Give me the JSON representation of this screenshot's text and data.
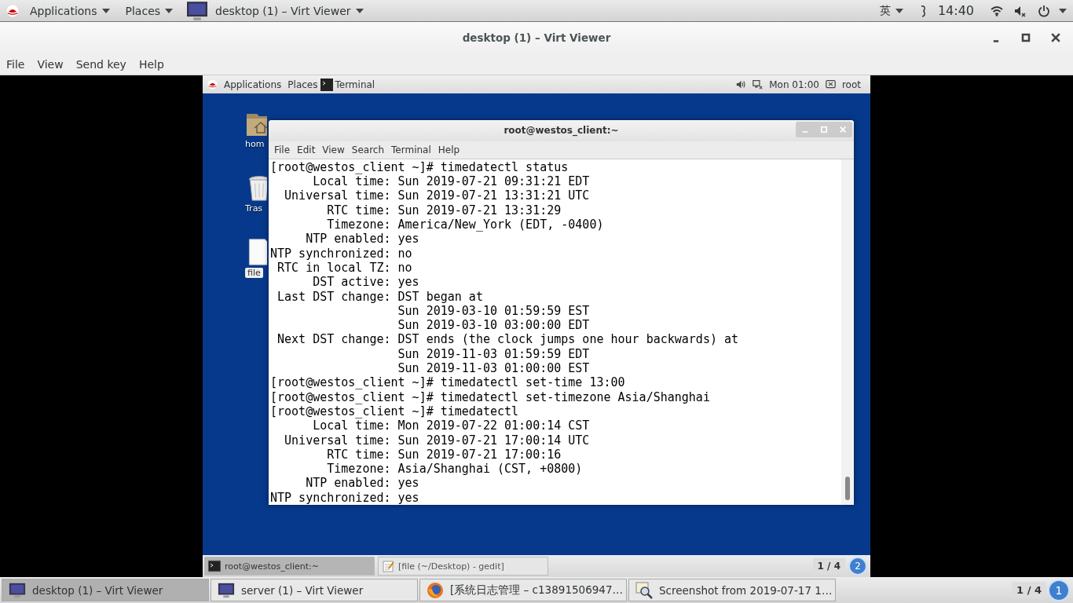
{
  "top_bar": {
    "menus": [
      "Applications",
      "Places"
    ],
    "window_button": "desktop (1) – Virt Viewer",
    "input_method": "英",
    "clock": "14:40"
  },
  "window": {
    "title": "desktop (1) – Virt Viewer",
    "menu": [
      "File",
      "View",
      "Send key",
      "Help"
    ]
  },
  "guest": {
    "top_bar": {
      "menus": [
        "Applications",
        "Places"
      ],
      "window_button": "Terminal",
      "clock": "Mon 01:00",
      "user": "root"
    },
    "desktop_icons": [
      {
        "kind": "folder",
        "label": "hom"
      },
      {
        "kind": "trash",
        "label": "Tras"
      },
      {
        "kind": "document",
        "label": "file"
      }
    ],
    "terminal": {
      "title": "root@westos_client:~",
      "menu": [
        "File",
        "Edit",
        "View",
        "Search",
        "Terminal",
        "Help"
      ],
      "lines": [
        "[root@westos_client ~]# timedatectl status",
        "      Local time: Sun 2019-07-21 09:31:21 EDT",
        "  Universal time: Sun 2019-07-21 13:31:21 UTC",
        "        RTC time: Sun 2019-07-21 13:31:29",
        "        Timezone: America/New_York (EDT, -0400)",
        "     NTP enabled: yes",
        "NTP synchronized: no",
        " RTC in local TZ: no",
        "      DST active: yes",
        " Last DST change: DST began at",
        "                  Sun 2019-03-10 01:59:59 EST",
        "                  Sun 2019-03-10 03:00:00 EDT",
        " Next DST change: DST ends (the clock jumps one hour backwards) at",
        "                  Sun 2019-11-03 01:59:59 EDT",
        "                  Sun 2019-11-03 01:00:00 EST",
        "[root@westos_client ~]# timedatectl set-time 13:00",
        "[root@westos_client ~]# timedatectl set-timezone Asia/Shanghai",
        "[root@westos_client ~]# timedatectl",
        "      Local time: Mon 2019-07-22 01:00:14 CST",
        "  Universal time: Sun 2019-07-21 17:00:14 UTC",
        "        RTC time: Sun 2019-07-21 17:00:16",
        "        Timezone: Asia/Shanghai (CST, +0800)",
        "     NTP enabled: yes",
        "NTP synchronized: yes"
      ]
    },
    "taskbar": {
      "windows": [
        {
          "kind": "terminal",
          "label": "root@westos_client:~",
          "selected": true
        },
        {
          "kind": "editor",
          "label": "[file (~/Desktop) - gedit]",
          "selected": false
        }
      ],
      "workspace": "1 / 4",
      "badge": "2"
    }
  },
  "taskbar": {
    "windows": [
      {
        "kind": "monitor",
        "label": "desktop (1) – Virt Viewer",
        "selected": true
      },
      {
        "kind": "monitor",
        "label": "server (1) – Virt Viewer",
        "selected": false
      },
      {
        "kind": "browser",
        "label": "[系统日志管理 – c13891506947…",
        "selected": false
      },
      {
        "kind": "viewer",
        "label": "Screenshot from 2019-07-17 1…",
        "selected": false
      }
    ],
    "workspace": "1 / 4",
    "badge": "1"
  }
}
